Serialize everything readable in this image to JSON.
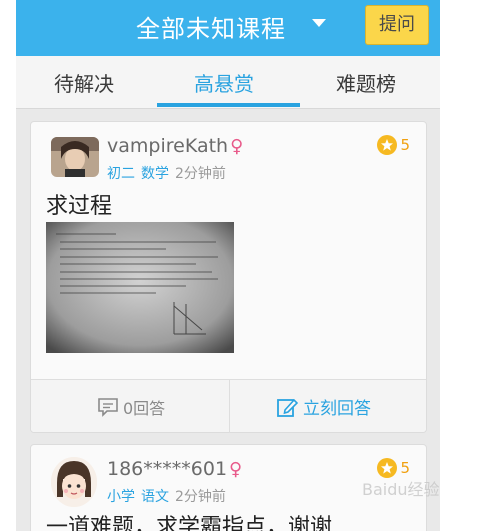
{
  "header": {
    "title": "全部未知课程",
    "ask_label": "提问"
  },
  "tabs": [
    {
      "label": "待解决",
      "active": false
    },
    {
      "label": "高悬赏",
      "active": true
    },
    {
      "label": "难题榜",
      "active": false
    }
  ],
  "posts": [
    {
      "username": "vampireKath",
      "gender_symbol": "♀",
      "grade": "初二",
      "subject": "数学",
      "time": "2分钟前",
      "reward": "5",
      "question": "求过程",
      "answer_count_label": "0回答",
      "answer_button_label": "立刻回答"
    },
    {
      "username": "186*****601",
      "gender_symbol": "♀",
      "grade": "小学",
      "subject": "语文",
      "time": "2分钟前",
      "reward": "5",
      "question": "一道难题，求学霸指点，谢谢"
    }
  ],
  "watermark": "Baidu经验",
  "colors": {
    "header": "#3bb2ec",
    "accent": "#2aa3e0",
    "ask_button": "#fbd64a",
    "coin": "#f6b921",
    "gender": "#e85a8a"
  },
  "icons": {
    "caret": "chevron-down-icon",
    "coin": "star-coin-icon",
    "answers": "comment-icon",
    "answer_now": "edit-icon"
  }
}
